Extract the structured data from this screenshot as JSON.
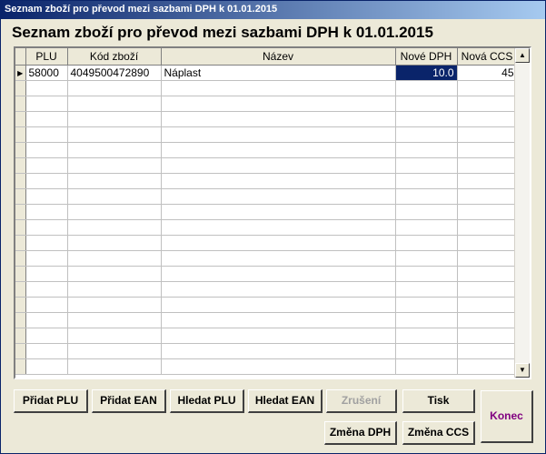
{
  "window": {
    "title": "Seznam zboží pro převod mezi sazbami DPH k 01.01.2015"
  },
  "heading": "Seznam zboží pro převod mezi sazbami DPH k 01.01.2015",
  "table": {
    "columns": [
      "PLU",
      "Kód zboží",
      "Název",
      "Nové DPH",
      "Nová CCS"
    ],
    "rows": [
      {
        "plu": "58000",
        "code": "4049500472890",
        "name": "Náplast",
        "vat": "10.0",
        "ccs": "45"
      }
    ]
  },
  "scrollbar": {
    "up_icon": "▲",
    "down_icon": "▼"
  },
  "row_indicator": "▶",
  "buttons": {
    "pridat_plu": "Přidat PLU",
    "pridat_ean": "Přidat EAN",
    "hledat_plu": "Hledat PLU",
    "hledat_ean": "Hledat EAN",
    "zruseni": "Zrušení",
    "tisk": "Tisk",
    "zmena_dph": "Změna DPH",
    "zmena_ccs": "Změna CCS",
    "konec": "Konec"
  },
  "colors": {
    "title_bar": "#0a246a",
    "selection": "#0a246a",
    "konec_text": "#800080"
  }
}
